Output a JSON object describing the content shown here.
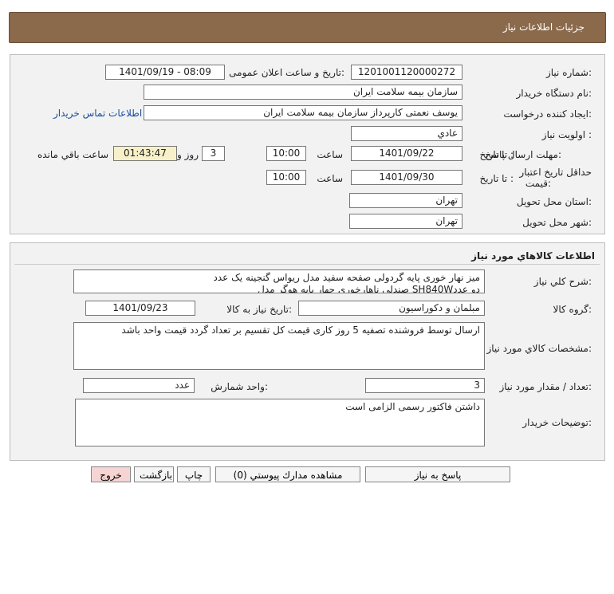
{
  "header": {
    "title": "جزئيات اطلاعات نياز"
  },
  "info": {
    "need_number_label": "شماره نياز:",
    "need_number": "1201001120000272",
    "announce_label": "تاریخ و ساعت اعلان عمومی:",
    "announce_value": "1401/09/19 - 08:09",
    "buyer_org_label": "نام دستگاه خريدار:",
    "buyer_org": "سازمان بیمه سلامت ایران",
    "creator_label": "ايجاد كننده درخواست:",
    "creator": "یوسف نعمتی کارپرداز سازمان بیمه سلامت ایران",
    "contact_link": "اطلاعات تماس خريدار",
    "priority_label": "اولويت نياز :",
    "priority": "عادي",
    "send_deadline_label": "مهلت ارسال پاسخ:",
    "to_date_label": "تا تاريخ :",
    "send_date": "1401/09/22",
    "time_label": "ساعت",
    "send_time": "10:00",
    "days": "3",
    "days_label": "روز و",
    "remaining": "01:43:47",
    "remaining_label": "ساعت باقي مانده",
    "validity_label_1": "حداقل تاريخ اعتبار",
    "validity_label_2": "قيمت:",
    "validity_to_label": "تا تاريخ :",
    "validity_date": "1401/09/30",
    "validity_time_label": "ساعت",
    "validity_time": "10:00",
    "province_label": "استان محل تحويل:",
    "province": "تهران",
    "city_label": "شهر محل تحويل:",
    "city": "تهران"
  },
  "goods": {
    "section_title": "اطلاعات كالاهاي مورد نياز",
    "desc_label": "شرح كلي نياز:",
    "desc_line1": "میز نهار خوری پایه گردولی صفحه سفید مدل ریواس گنجینه یک عدد",
    "desc_line2": "صندلی ناهارخوری چهار پایه هوگر مدل SH840Wدو عدد",
    "group_label": "گروه كالا:",
    "group": "مبلمان و دکوراسیون",
    "need_date_label": "تاریخ نیاز به کالا:",
    "need_date": "1401/09/23",
    "spec_label": "مشخصات كالاي مورد نياز:",
    "spec": "ارسال توسط فروشنده تصفیه 5 روز کاری قیمت کل تقسیم بر تعداد گردد قیمت واحد باشد",
    "qty_label": "تعداد / مقدار مورد نياز:",
    "qty": "3",
    "unit_label": "واحد شمارش:",
    "unit": "عدد",
    "notes_label": "توضيحات خريدار:",
    "notes": "داشتن فاکتور رسمی الزامی است"
  },
  "buttons": {
    "reply": "پاسخ به نياز",
    "attachments": "مشاهده مدارك پيوستي (0)",
    "print": "چاپ",
    "back": "بازگشت",
    "exit": "خروج"
  }
}
